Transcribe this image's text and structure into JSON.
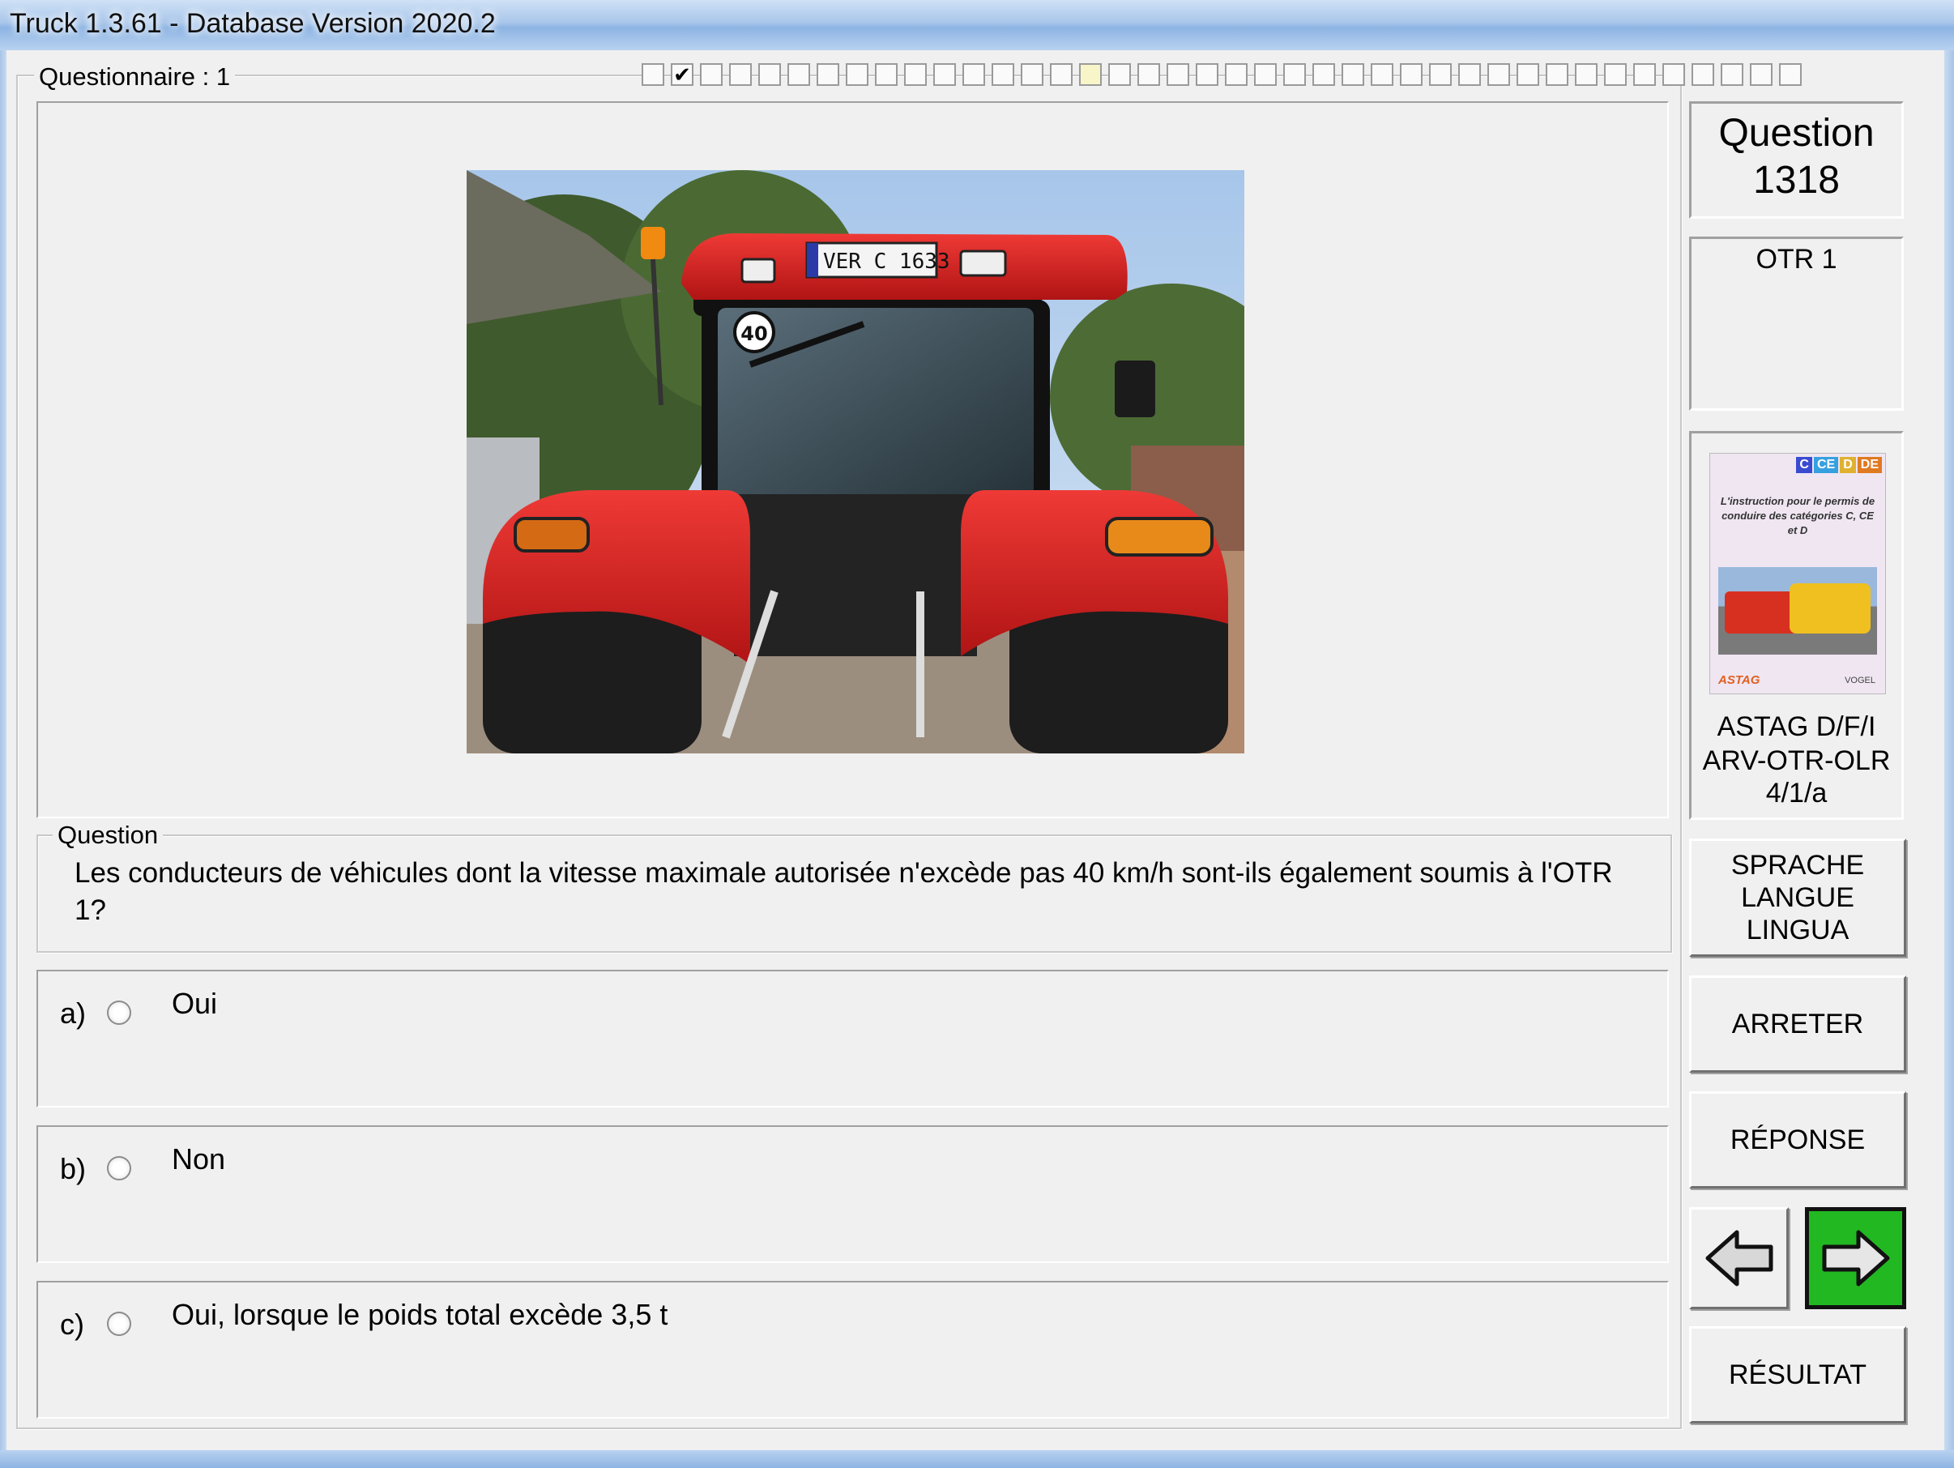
{
  "window": {
    "title": "Truck 1.3.61 - Database Version 2020.2"
  },
  "questionnaire": {
    "label": "Questionnaire : 1",
    "progress_total": 40,
    "progress_checked_index": 1,
    "progress_current_index": 15
  },
  "question": {
    "group_label": "Question",
    "text": "Les conducteurs de véhicules dont la vitesse maximale autorisée n'excède pas 40 km/h sont-ils également soumis à l'OTR 1?"
  },
  "picture": {
    "plate": "VER C 1633",
    "speed_sign": "40"
  },
  "answers": [
    {
      "letter": "a)",
      "text": "Oui"
    },
    {
      "letter": "b)",
      "text": "Non"
    },
    {
      "letter": "c)",
      "text": "Oui, lorsque le poids total excède 3,5 t"
    }
  ],
  "side": {
    "question_title": "Question",
    "question_number": "1318",
    "category": "OTR 1",
    "book_cover_tags": [
      "C",
      "CE",
      "D",
      "DE"
    ],
    "book_cover_text": "L'instruction pour le permis de conduire des catégories C, CE et D",
    "book_brand": "ASTAG",
    "book_publisher": "VOGEL",
    "book_reference_line1": "ASTAG D/F/I",
    "book_reference_line2": "ARV-OTR-OLR",
    "book_reference_line3": "4/1/a"
  },
  "buttons": {
    "language_line1": "SPRACHE",
    "language_line2": "LANGUE",
    "language_line3": "LINGUA",
    "stop": "ARRETER",
    "answer": "RÉPONSE",
    "result": "RÉSULTAT"
  },
  "colors": {
    "next_button": "#22b822",
    "tractor_red": "#d81e1e"
  }
}
